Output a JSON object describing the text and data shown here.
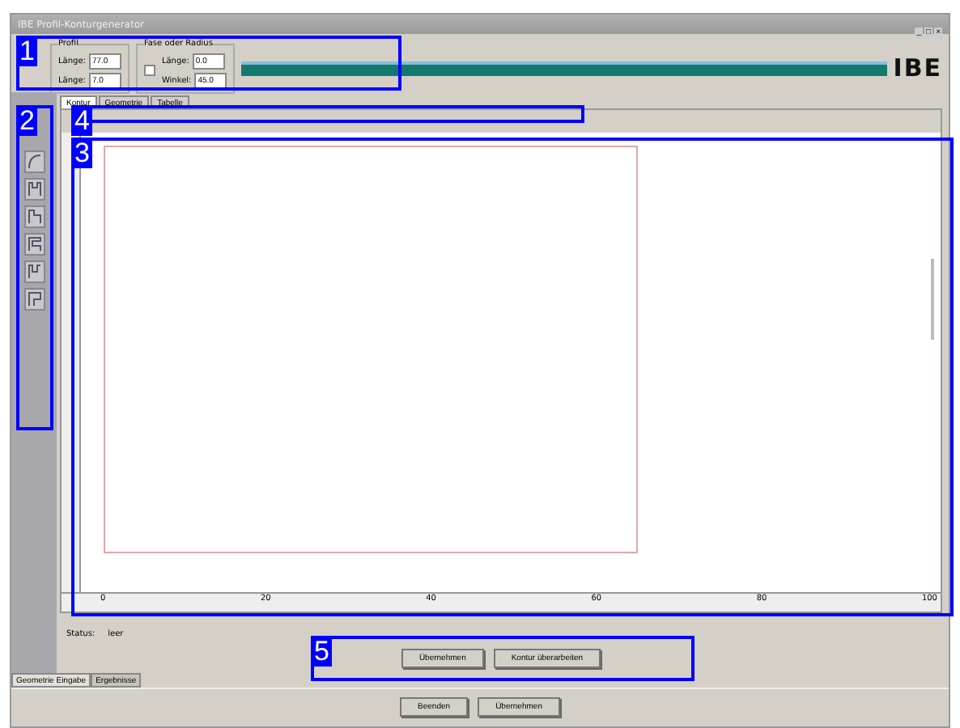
{
  "window": {
    "title": "IBE Profil-Konturgenerator",
    "controls": [
      "_",
      "□",
      "×"
    ]
  },
  "header": {
    "group_1": {
      "title": "Profil",
      "fields": [
        {
          "label": "Länge:",
          "value": "77.0"
        },
        {
          "label": "Länge:",
          "value": "7.0"
        }
      ]
    },
    "group_2": {
      "title": "Fase oder Radius",
      "checked": false,
      "fields": [
        {
          "label": "Länge:",
          "value": "0.0"
        },
        {
          "label": "Winkel:",
          "value": "45.0"
        }
      ]
    },
    "logo": "IBE"
  },
  "tabs": [
    {
      "label": "Kontur",
      "selected": true
    },
    {
      "label": "Geometrie",
      "selected": false
    },
    {
      "label": "Tabelle",
      "selected": false
    }
  ],
  "x_axis_labels": [
    "0",
    "20",
    "40",
    "60",
    "80",
    "100"
  ],
  "status": {
    "label": "Status:",
    "value": "leer"
  },
  "actions": [
    "Übernehmen",
    "Kontur überarbeiten"
  ],
  "bottom_tabs": [
    {
      "label": "Geometrie Eingabe",
      "selected": true
    },
    {
      "label": "Ergebnisse",
      "selected": false
    }
  ],
  "footer_buttons": [
    "Beenden",
    "Übernehmen"
  ],
  "callouts": [
    "1",
    "2",
    "3",
    "4",
    "5"
  ]
}
